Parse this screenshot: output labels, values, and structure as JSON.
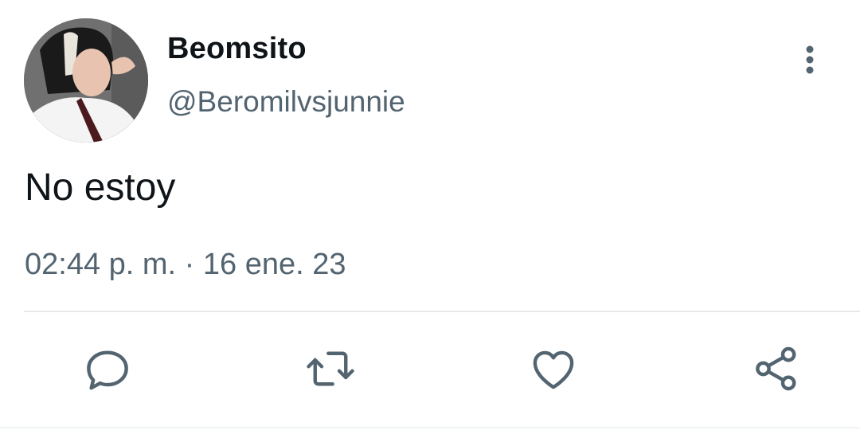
{
  "tweet": {
    "author": {
      "display_name": "Beomsito",
      "handle": "@Beromilvsjunnie"
    },
    "text": "No estoy",
    "timestamp": "02:44 p. m. · 16 ene. 23"
  },
  "icons": {
    "more": "more-vertical-icon",
    "reply": "reply-icon",
    "retweet": "retweet-icon",
    "like": "heart-icon",
    "share": "share-icon"
  },
  "colors": {
    "text_primary": "#0f1419",
    "text_secondary": "#536471",
    "icon": "#536471",
    "divider": "#e7e9ea"
  }
}
